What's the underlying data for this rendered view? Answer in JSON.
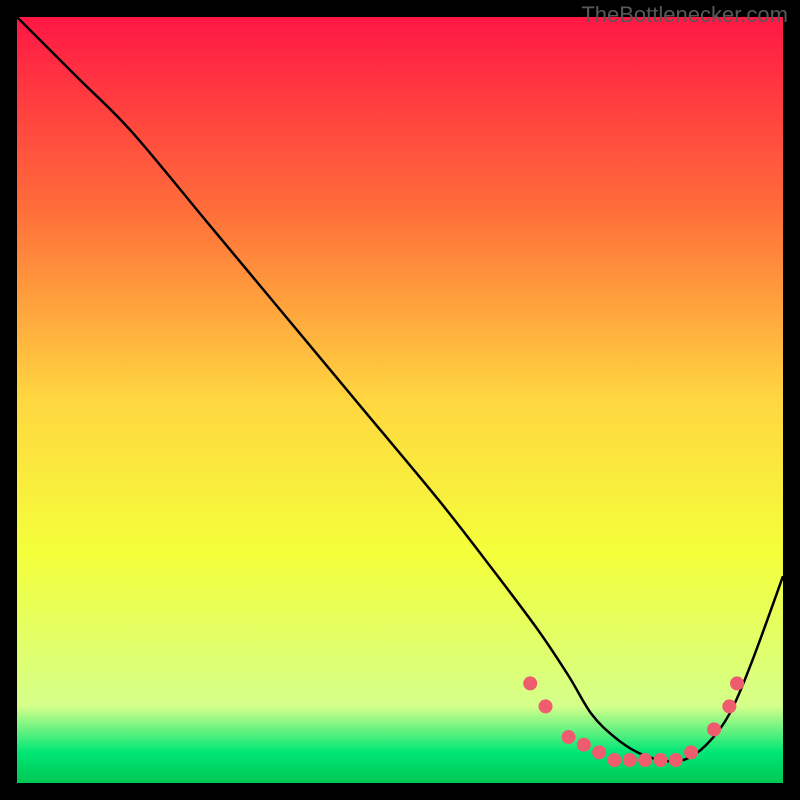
{
  "watermark": "TheBottlenecker.com",
  "chart_data": {
    "type": "line",
    "title": "",
    "xlabel": "",
    "ylabel": "",
    "xlim": [
      0,
      100
    ],
    "ylim": [
      0,
      100
    ],
    "gradient_stops": [
      {
        "offset": 0,
        "color": "#ff1744"
      },
      {
        "offset": 25,
        "color": "#ff6d3a"
      },
      {
        "offset": 50,
        "color": "#ffd740"
      },
      {
        "offset": 70,
        "color": "#f4ff3a"
      },
      {
        "offset": 90,
        "color": "#d4ff8a"
      },
      {
        "offset": 96,
        "color": "#00e676"
      },
      {
        "offset": 100,
        "color": "#00c853"
      }
    ],
    "series": [
      {
        "name": "bottleneck-curve",
        "x": [
          0,
          3,
          8,
          15,
          25,
          35,
          45,
          55,
          62,
          68,
          72,
          75,
          78,
          81,
          84,
          87,
          90,
          93,
          96,
          100
        ],
        "y": [
          100,
          97,
          92,
          85,
          73,
          61,
          49,
          37,
          28,
          20,
          14,
          9,
          6,
          4,
          3,
          3,
          5,
          9,
          16,
          27
        ]
      }
    ],
    "markers": {
      "name": "data-points",
      "color": "#ef5c6e",
      "points": [
        {
          "x": 67,
          "y": 13
        },
        {
          "x": 69,
          "y": 10
        },
        {
          "x": 72,
          "y": 6
        },
        {
          "x": 74,
          "y": 5
        },
        {
          "x": 76,
          "y": 4
        },
        {
          "x": 78,
          "y": 3
        },
        {
          "x": 80,
          "y": 3
        },
        {
          "x": 82,
          "y": 3
        },
        {
          "x": 84,
          "y": 3
        },
        {
          "x": 86,
          "y": 3
        },
        {
          "x": 88,
          "y": 4
        },
        {
          "x": 91,
          "y": 7
        },
        {
          "x": 93,
          "y": 10
        },
        {
          "x": 94,
          "y": 13
        }
      ]
    }
  }
}
